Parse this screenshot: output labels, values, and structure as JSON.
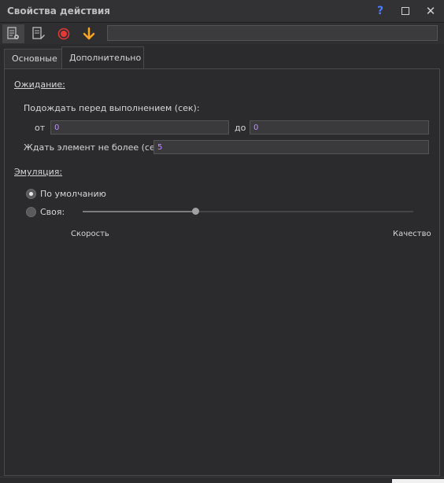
{
  "window": {
    "title": "Свойства действия",
    "help_label": "?",
    "close_label": "✕"
  },
  "toolbar": {
    "tools": [
      {
        "icon": "properties-doc-icon"
      },
      {
        "icon": "edit-doc-icon"
      },
      {
        "icon": "record-icon"
      },
      {
        "icon": "arrow-down-icon"
      }
    ],
    "input_value": ""
  },
  "tabs": [
    {
      "label": "Основные",
      "active": false
    },
    {
      "label": "Дополнительно",
      "active": true
    }
  ],
  "waiting": {
    "section_label": "Ожидание:",
    "wait_before_label": "Подождать перед выполнением (сек):",
    "from_label": "от",
    "from_value": "0",
    "to_label": "до",
    "to_value": "0",
    "wait_element_label": "Ждать элемент не более (сек):",
    "wait_element_value": "5"
  },
  "emulation": {
    "section_label": "Эмуляция:",
    "default_label": "По умолчанию",
    "custom_label": "Своя:",
    "selected": "default",
    "slider_value": 0.34,
    "speed_label": "Скорость",
    "quality_label": "Качество"
  },
  "colors": {
    "accent": "#c08cff",
    "record": "#e53935",
    "arrow": "#f5a623",
    "help": "#4a7cff"
  }
}
